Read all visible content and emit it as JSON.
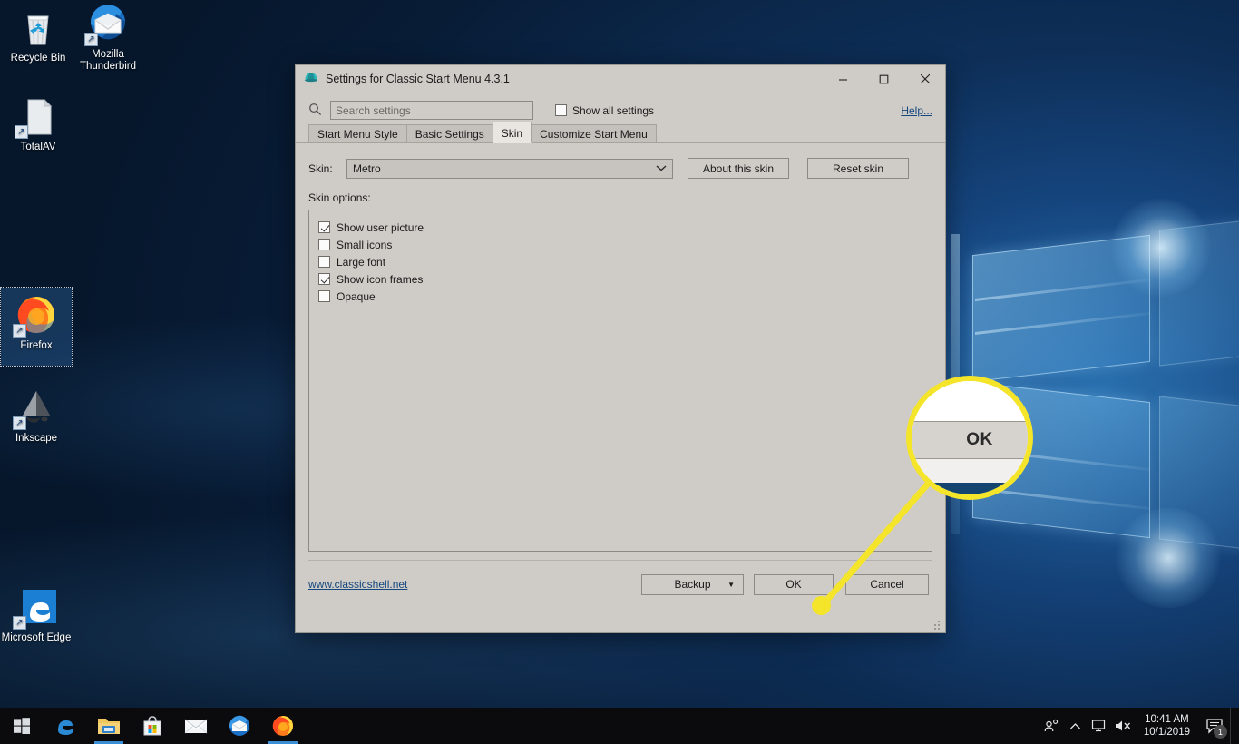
{
  "desktop": {
    "icons": [
      {
        "name": "Recycle Bin",
        "icon": "recycle-bin-icon",
        "shortcut": false,
        "selected": false
      },
      {
        "name": "Mozilla Thunderbird",
        "icon": "thunderbird-icon",
        "shortcut": true,
        "selected": false
      },
      {
        "name": "TotalAV",
        "icon": "document-icon",
        "shortcut": true,
        "selected": false
      },
      {
        "name": "Firefox",
        "icon": "firefox-icon",
        "shortcut": true,
        "selected": true
      },
      {
        "name": "Inkscape",
        "icon": "inkscape-icon",
        "shortcut": true,
        "selected": false
      },
      {
        "name": "Microsoft Edge",
        "icon": "edge-icon",
        "shortcut": true,
        "selected": false
      }
    ]
  },
  "dialog": {
    "title": "Settings for Classic Start Menu 4.3.1",
    "app_icon": "classic-shell-icon",
    "window_buttons": {
      "minimize": "─",
      "maximize": "☐",
      "close": "✕"
    },
    "search": {
      "placeholder": "Search settings",
      "value": "",
      "icon": "search-icon"
    },
    "show_all_settings": {
      "label": "Show all settings",
      "checked": false
    },
    "help_link": "Help...",
    "tabs": [
      {
        "label": "Start Menu Style",
        "active": false
      },
      {
        "label": "Basic Settings",
        "active": false
      },
      {
        "label": "Skin",
        "active": true
      },
      {
        "label": "Customize Start Menu",
        "active": false
      }
    ],
    "skin": {
      "label": "Skin:",
      "selected": "Metro",
      "dropdown_icon": "chevron-down-icon",
      "about_button": "About this skin",
      "reset_button": "Reset skin"
    },
    "skin_options_label": "Skin options:",
    "skin_options": [
      {
        "label": "Show user picture",
        "checked": true
      },
      {
        "label": "Small icons",
        "checked": false
      },
      {
        "label": "Large font",
        "checked": false
      },
      {
        "label": "Show icon frames",
        "checked": true
      },
      {
        "label": "Opaque",
        "checked": false
      }
    ],
    "footer": {
      "site_link": "www.classicshell.net",
      "backup_button": "Backup",
      "backup_dropdown_icon": "caret-down-icon",
      "ok_button": "OK",
      "cancel_button": "Cancel"
    }
  },
  "callout": {
    "magnified_label": "OK",
    "highlight_color": "#f5e52a"
  },
  "taskbar": {
    "start": {
      "icon": "windows-start-icon"
    },
    "items": [
      {
        "icon": "edge-icon",
        "name": "Microsoft Edge",
        "active": false
      },
      {
        "icon": "file-explorer-icon",
        "name": "File Explorer",
        "active": true
      },
      {
        "icon": "microsoft-store-icon",
        "name": "Microsoft Store",
        "active": false
      },
      {
        "icon": "mail-icon",
        "name": "Mail",
        "active": false
      },
      {
        "icon": "thunderbird-icon",
        "name": "Mozilla Thunderbird",
        "active": false
      },
      {
        "icon": "firefox-icon",
        "name": "Firefox",
        "active": true
      }
    ],
    "tray": [
      {
        "icon": "people-icon",
        "glyph": "ʀᴿ"
      },
      {
        "icon": "chevron-up-icon",
        "glyph": "∧"
      },
      {
        "icon": "network-icon",
        "glyph": "Ὓ3"
      },
      {
        "icon": "speaker-muted-icon",
        "glyph": "ὖ8×"
      }
    ],
    "clock": {
      "time": "10:41 AM",
      "date": "10/1/2019"
    },
    "notifications": {
      "icon": "action-center-icon",
      "count": "1"
    }
  }
}
